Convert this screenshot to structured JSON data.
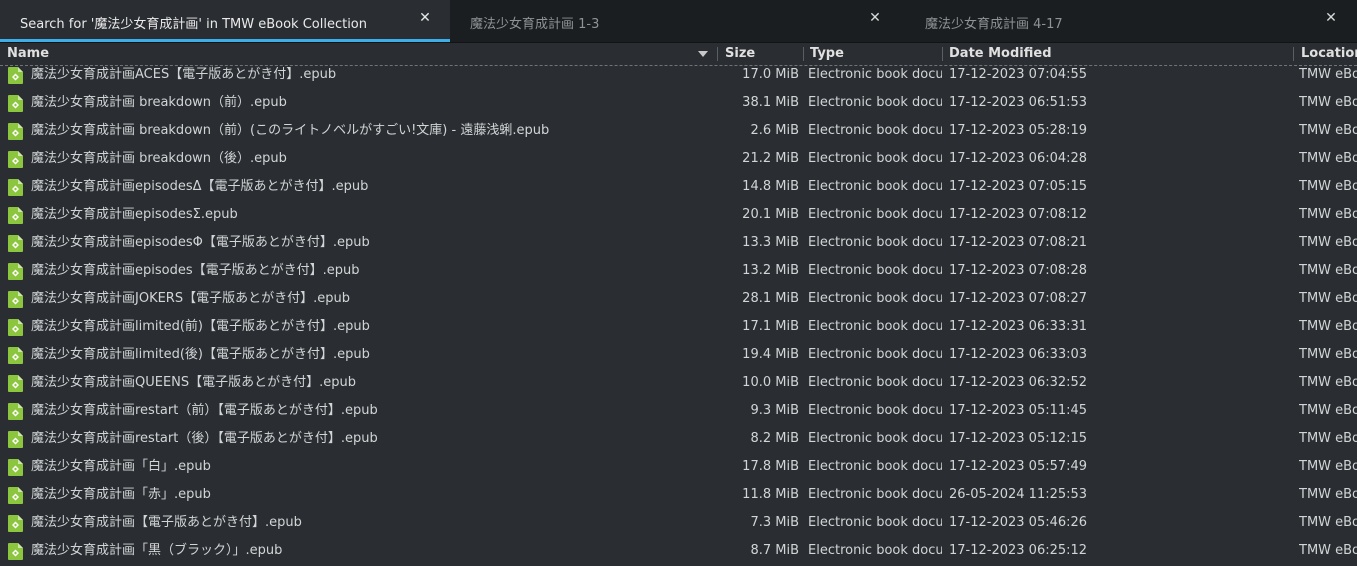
{
  "tabs": [
    {
      "label": "Search for '魔法少女育成計画' in TMW eBook Collection",
      "close": "✕",
      "active": true
    },
    {
      "label": "魔法少女育成計画 1-3",
      "close": "✕",
      "active": false
    },
    {
      "label": "魔法少女育成計画 4-17",
      "close": "✕",
      "active": false
    }
  ],
  "columns": {
    "name": "Name",
    "size": "Size",
    "type": "Type",
    "date": "Date Modified",
    "location": "Location"
  },
  "accent_color": "#3daee9",
  "file_icon": "epub-file-icon",
  "rows": [
    {
      "name": "魔法少女育成計画ACES【電子版あとがき付】.epub",
      "size": "17.0 MiB",
      "type": "Electronic book docun",
      "date": "17-12-2023 07:04:55",
      "location": "TMW eBo"
    },
    {
      "name": "魔法少女育成計画 breakdown（前）.epub",
      "size": "38.1 MiB",
      "type": "Electronic book docun",
      "date": "17-12-2023 06:51:53",
      "location": "TMW eBo"
    },
    {
      "name": "魔法少女育成計画 breakdown（前）(このライトノベルがすごい!文庫) - 遠藤浅蜊.epub",
      "size": "2.6 MiB",
      "type": "Electronic book docun",
      "date": "17-12-2023 05:28:19",
      "location": "TMW eBo"
    },
    {
      "name": "魔法少女育成計画 breakdown（後）.epub",
      "size": "21.2 MiB",
      "type": "Electronic book docun",
      "date": "17-12-2023 06:04:28",
      "location": "TMW eBo"
    },
    {
      "name": "魔法少女育成計画episodesΔ【電子版あとがき付】.epub",
      "size": "14.8 MiB",
      "type": "Electronic book docun",
      "date": "17-12-2023 07:05:15",
      "location": "TMW eBo"
    },
    {
      "name": "魔法少女育成計画episodesΣ.epub",
      "size": "20.1 MiB",
      "type": "Electronic book docun",
      "date": "17-12-2023 07:08:12",
      "location": "TMW eBo"
    },
    {
      "name": "魔法少女育成計画episodesΦ【電子版あとがき付】.epub",
      "size": "13.3 MiB",
      "type": "Electronic book docun",
      "date": "17-12-2023 07:08:21",
      "location": "TMW eBo"
    },
    {
      "name": "魔法少女育成計画episodes【電子版あとがき付】.epub",
      "size": "13.2 MiB",
      "type": "Electronic book docun",
      "date": "17-12-2023 07:08:28",
      "location": "TMW eBo"
    },
    {
      "name": "魔法少女育成計画JOKERS【電子版あとがき付】.epub",
      "size": "28.1 MiB",
      "type": "Electronic book docun",
      "date": "17-12-2023 07:08:27",
      "location": "TMW eBo"
    },
    {
      "name": "魔法少女育成計画limited(前)【電子版あとがき付】.epub",
      "size": "17.1 MiB",
      "type": "Electronic book docun",
      "date": "17-12-2023 06:33:31",
      "location": "TMW eBo"
    },
    {
      "name": "魔法少女育成計画limited(後)【電子版あとがき付】.epub",
      "size": "19.4 MiB",
      "type": "Electronic book docun",
      "date": "17-12-2023 06:33:03",
      "location": "TMW eBo"
    },
    {
      "name": "魔法少女育成計画QUEENS【電子版あとがき付】.epub",
      "size": "10.0 MiB",
      "type": "Electronic book docun",
      "date": "17-12-2023 06:32:52",
      "location": "TMW eBo"
    },
    {
      "name": "魔法少女育成計画restart（前）【電子版あとがき付】.epub",
      "size": "9.3 MiB",
      "type": "Electronic book docun",
      "date": "17-12-2023 05:11:45",
      "location": "TMW eBo"
    },
    {
      "name": "魔法少女育成計画restart（後）【電子版あとがき付】.epub",
      "size": "8.2 MiB",
      "type": "Electronic book docun",
      "date": "17-12-2023 05:12:15",
      "location": "TMW eBo"
    },
    {
      "name": "魔法少女育成計画「白」.epub",
      "size": "17.8 MiB",
      "type": "Electronic book docun",
      "date": "17-12-2023 05:57:49",
      "location": "TMW eBo"
    },
    {
      "name": "魔法少女育成計画「赤」.epub",
      "size": "11.8 MiB",
      "type": "Electronic book docun",
      "date": "26-05-2024 11:25:53",
      "location": "TMW eBo"
    },
    {
      "name": "魔法少女育成計画【電子版あとがき付】.epub",
      "size": "7.3 MiB",
      "type": "Electronic book docun",
      "date": "17-12-2023 05:46:26",
      "location": "TMW eBo"
    },
    {
      "name": "魔法少女育成計画「黒（ブラック）」.epub",
      "size": "8.7 MiB",
      "type": "Electronic book docun",
      "date": "17-12-2023 06:25:12",
      "location": "TMW eBo"
    }
  ]
}
